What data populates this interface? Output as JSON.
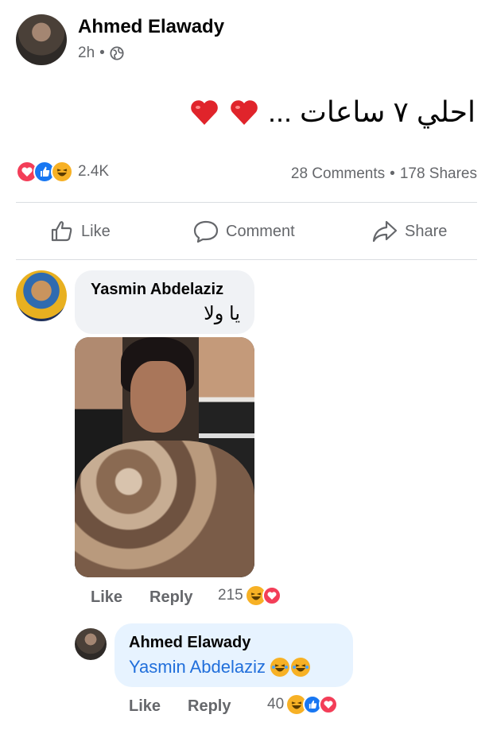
{
  "post": {
    "author": "Ahmed Elawady",
    "time": "2h",
    "separator": "•",
    "text": "احلي ٧ ساعات ...",
    "privacy_icon": "globe-icon"
  },
  "stats": {
    "reactions_count": "2.4K",
    "comments": "28 Comments",
    "dot": "•",
    "shares": "178 Shares",
    "reaction_icons": [
      "love-icon",
      "like-icon",
      "haha-icon"
    ]
  },
  "actions": {
    "like": "Like",
    "comment": "Comment",
    "share": "Share"
  },
  "comments": [
    {
      "author": "Yasmin Abdelaziz",
      "text": "يا ولا",
      "like_label": "Like",
      "reply_label": "Reply",
      "reaction_count": "215",
      "reaction_icons": [
        "haha-icon",
        "love-icon"
      ]
    },
    {
      "author": "Ahmed Elawady",
      "mention": "Yasmin Abdelaziz",
      "like_label": "Like",
      "reply_label": "Reply",
      "reaction_count": "40",
      "reaction_icons": [
        "haha-icon",
        "like-icon",
        "love-icon"
      ]
    }
  ],
  "colors": {
    "like_blue": "#1877f2",
    "love_red": "#f33e58",
    "haha_yellow": "#f7b125",
    "mention_blue": "#216fdb",
    "bubble_bg": "#f0f2f5",
    "reply_bubble_bg": "#e7f3ff"
  }
}
